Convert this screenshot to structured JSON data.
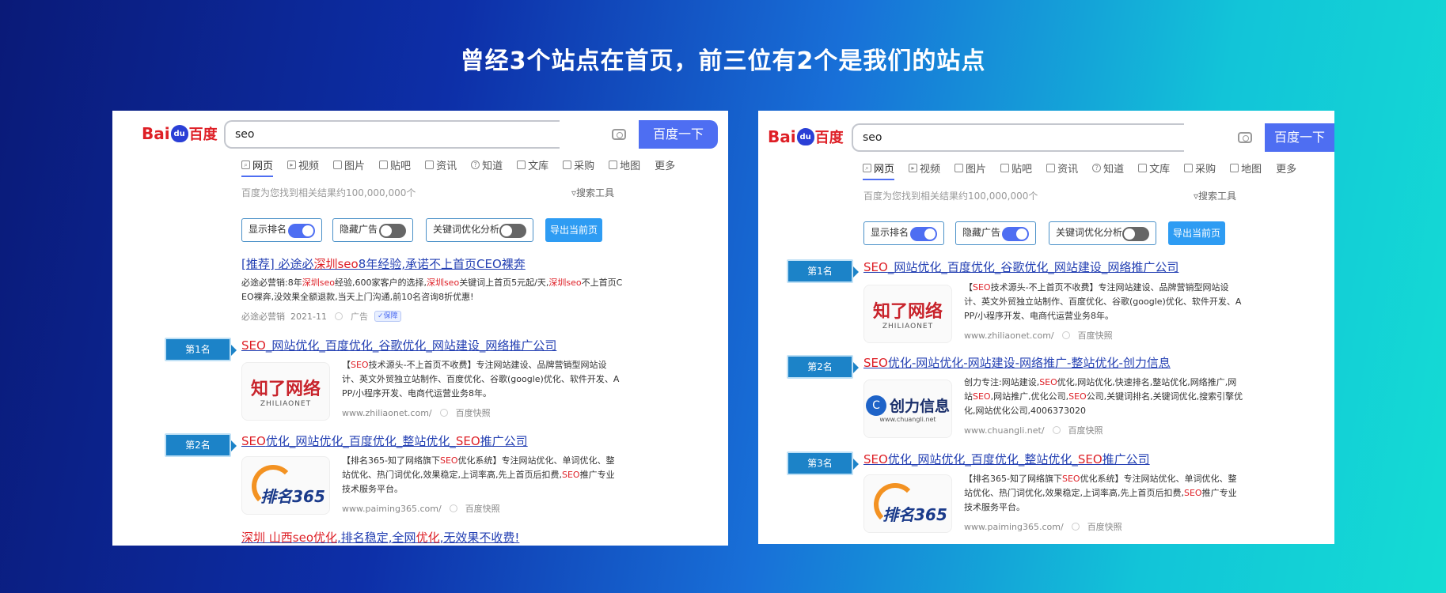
{
  "headline": "曾经3个站点在首页，前三位有2个是我们的站点",
  "colors": {
    "accent": "#4e6ef2",
    "link": "#2440b3",
    "highlight": "#de1f26",
    "badge": "#1c83c8",
    "export": "#2e9cf3"
  },
  "left": {
    "logo": {
      "en1": "Bai",
      "paw": "du",
      "cn": "百度"
    },
    "search": {
      "query": "seo",
      "button": "百度一下"
    },
    "tabs": [
      "网页",
      "视频",
      "图片",
      "贴吧",
      "资讯",
      "知道",
      "文库",
      "采购",
      "地图",
      "更多"
    ],
    "result_count": "百度为您找到相关结果约100,000,000个",
    "search_tools": "搜索工具",
    "toggles": [
      {
        "label": "显示排名",
        "state": "on"
      },
      {
        "label": "隐藏广告",
        "state": "off"
      },
      {
        "label": "关键词优化分析",
        "state": "off"
      }
    ],
    "export": "导出当前页",
    "ad": {
      "title_a": "[推荐] 必途必",
      "title_hl": "深圳seo",
      "title_b": "8年经验,承诺不上首页CEO裸奔",
      "desc_1a": "必途必营销:8年",
      "desc_1hl": "深圳seo",
      "desc_1b": "经验,600家客户的选择,",
      "desc_1hl2": "深圳seo",
      "desc_1c": "关键词上首页5元起/天,",
      "desc_1hl3": "深圳seo",
      "desc_1d": "不上首页C",
      "desc_2": "EO裸奔,没效果全额退款,当天上门沟通,前10名咨询8折优惠!",
      "meta_source": "必途必营销",
      "meta_date": "2021-11",
      "meta_ad": "广告",
      "meta_badge": "保障"
    },
    "r1": {
      "rank": "第1名",
      "title_hl": "SEO",
      "title": "_网站优化_百度优化_谷歌优化_网站建设_网络推广公司",
      "desc_1a": "【",
      "desc_1hl": "SEO",
      "desc_1b": "技术源头-不上首页不收费】专注网站建设、品牌营销型网站设",
      "desc_2": "计、英文外贸独立站制作、百度优化、谷歌(google)优化、软件开发、A",
      "desc_3": "PP/小程序开发、电商代运营业务8年。",
      "url": "www.zhiliaonet.com/",
      "snapshot": "百度快照",
      "logo_big": "知了网络",
      "logo_small": "ZHILIAONET"
    },
    "r2": {
      "rank": "第2名",
      "title_hl": "SEO",
      "title_a": "优化_网站优化_百度优化_整站优化_",
      "title_hl2": "SEO",
      "title_b": "推广公司",
      "desc_1a": "【排名365-知了网络旗下",
      "desc_1hl": "SEO",
      "desc_1b": "优化系统】专注网站优化、单词优化、整",
      "desc_2a": "站优化、热门词优化,效果稳定,上词率高,先上首页后扣费,",
      "desc_2hl": "SEO",
      "desc_2b": "推广专业",
      "desc_3": "技术服务平台。",
      "url": "www.paiming365.com/",
      "snapshot": "百度快照",
      "logo_big": "排名365"
    },
    "r3": {
      "title_a": "深圳 山西",
      "title_hl": "seo优化",
      "title_b": ",排名稳定,全网",
      "title_hl2": "优化",
      "title_c": ",无效果不收费!"
    }
  },
  "right": {
    "logo": {
      "en1": "Bai",
      "paw": "du",
      "cn": "百度"
    },
    "search": {
      "query": "seo",
      "button": "百度一下"
    },
    "tabs": [
      "网页",
      "视频",
      "图片",
      "贴吧",
      "资讯",
      "知道",
      "文库",
      "采购",
      "地图",
      "更多"
    ],
    "result_count": "百度为您找到相关结果约100,000,000个",
    "search_tools": "搜索工具",
    "toggles": [
      {
        "label": "显示排名",
        "state": "on"
      },
      {
        "label": "隐藏广告",
        "state": "on"
      },
      {
        "label": "关键词优化分析",
        "state": "off"
      }
    ],
    "export": "导出当前页",
    "r1": {
      "rank": "第1名",
      "title_hl": "SEO",
      "title": "_网站优化_百度优化_谷歌优化_网站建设_网络推广公司",
      "desc_1a": "【",
      "desc_1hl": "SEO",
      "desc_1b": "技术源头-不上首页不收费】专注网站建设、品牌营销型网站设",
      "desc_2": "计、英文外贸独立站制作、百度优化、谷歌(google)优化、软件开发、A",
      "desc_3": "PP/小程序开发、电商代运营业务8年。",
      "url": "www.zhiliaonet.com/",
      "snapshot": "百度快照",
      "logo_big": "知了网络",
      "logo_small": "ZHILIAONET"
    },
    "r2": {
      "rank": "第2名",
      "title_hl": "SEO",
      "title": "优化-网站优化-网站建设-网络推广-整站优化-创力信息",
      "desc_1": "创力专注:网站建设,",
      "desc_1hl": "SEO",
      "desc_1b": "优化,网站优化,快速排名,整站优化,网络推广,网",
      "desc_2a": "站",
      "desc_2hl": "SEO",
      "desc_2b": ",网站推广,优化公司,",
      "desc_2hl2": "SEO",
      "desc_2c": "公司,关键词排名,关键词优化,搜索引擎优",
      "desc_3": "化,网站优化公司,4006373020",
      "url": "www.chuangli.net/",
      "snapshot": "百度快照",
      "logo_big": "创力信息",
      "logo_circle": "C",
      "logo_small": "www.chuangli.net"
    },
    "r3": {
      "rank": "第3名",
      "title_hl": "SEO",
      "title_a": "优化_网站优化_百度优化_整站优化_",
      "title_hl2": "SEO",
      "title_b": "推广公司",
      "desc_1a": "【排名365-知了网络旗下",
      "desc_1hl": "SEO",
      "desc_1b": "优化系统】专注网站优化、单词优化、整",
      "desc_2a": "站优化、热门词优化,效果稳定,上词率高,先上首页后扣费,",
      "desc_2hl": "SEO",
      "desc_2b": "推广专业",
      "desc_3": "技术服务平台。",
      "url": "www.paiming365.com/",
      "snapshot": "百度快照",
      "logo_big": "排名365"
    }
  }
}
